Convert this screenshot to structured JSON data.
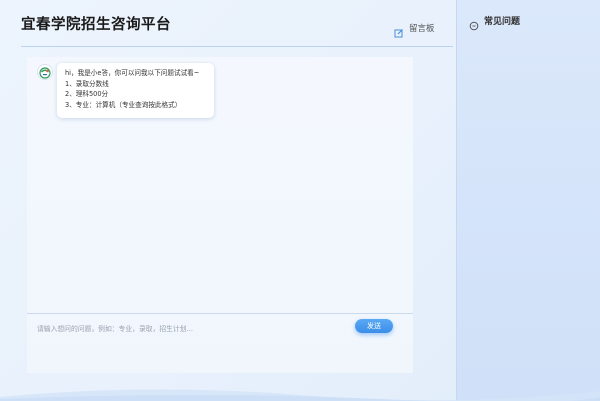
{
  "header": {
    "title": "宜春学院招生咨询平台",
    "message_board_label": "留言板"
  },
  "chat": {
    "greeting_lines": [
      "hi，我是小e答，你可以问我以下问题试试看~",
      "1、录取分数线",
      "2、理科500分",
      "3、专业：计算机（专业查询按此格式）"
    ],
    "input_placeholder": "请输入想问的问题，例如：专业，录取，招生计划...",
    "send_label": "发送"
  },
  "sidebar": {
    "faq_title": "常见问题"
  },
  "icons": {
    "message_board": "edit-icon",
    "faq": "chat-bubble-icon",
    "avatar": "bot-avatar-icon"
  },
  "colors": {
    "accent": "#3a8ee8",
    "header_rule": "#bcd3ef"
  }
}
